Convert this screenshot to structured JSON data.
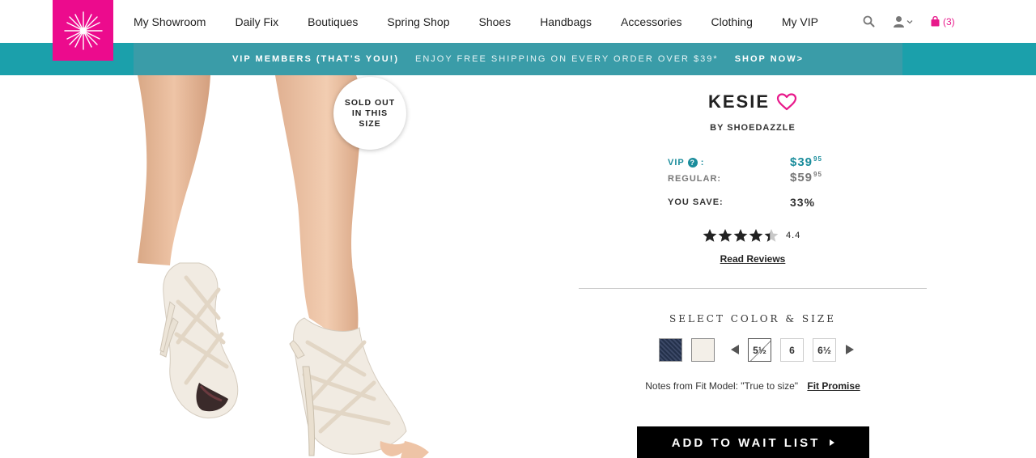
{
  "nav": {
    "items": [
      {
        "name": "nav-my-showroom",
        "label": "My Showroom"
      },
      {
        "name": "nav-daily-fix",
        "label": "Daily Fix"
      },
      {
        "name": "nav-boutiques",
        "label": "Boutiques"
      },
      {
        "name": "nav-spring-shop",
        "label": "Spring Shop"
      },
      {
        "name": "nav-shoes",
        "label": "Shoes"
      },
      {
        "name": "nav-handbags",
        "label": "Handbags"
      },
      {
        "name": "nav-accessories",
        "label": "Accessories"
      },
      {
        "name": "nav-clothing",
        "label": "Clothing"
      },
      {
        "name": "nav-my-vip",
        "label": "My VIP"
      }
    ],
    "bag_count": "(3)",
    "icons": [
      "search-icon",
      "user-icon",
      "chevron-down-icon",
      "shopping-bag-icon"
    ]
  },
  "promo": {
    "left": "VIP MEMBERS (THAT'S YOU!)",
    "middle": "ENJOY FREE SHIPPING ON EVERY ORDER OVER $39*",
    "cta": "SHOP NOW>"
  },
  "badge": {
    "line1": "SOLD OUT",
    "line2": "IN THIS",
    "line3": "SIZE"
  },
  "product": {
    "name": "KESIE",
    "brand": "BY SHOEDAZZLE",
    "vip_label": "VIP",
    "vip_colon": ":",
    "vip_price": "$39",
    "vip_cents": "95",
    "regular_label": "REGULAR:",
    "regular_price": "$59",
    "regular_cents": "95",
    "save_label": "YOU SAVE:",
    "save_value": "33%",
    "rating": 4.4,
    "rating_text": "4.4",
    "stars_max": 5,
    "read_reviews": "Read Reviews"
  },
  "selector": {
    "title": "SELECT COLOR & SIZE",
    "colors": [
      "denim",
      "cream"
    ],
    "sizes": [
      "5½",
      "6",
      "6½"
    ],
    "fit_notes": "Notes from Fit Model: \"True to size\"",
    "fit_promise": "Fit Promise"
  },
  "cta": {
    "label": "ADD TO WAIT LIST"
  },
  "colors": {
    "brand_pink": "#ec0b8d",
    "promo_teal": "#1ba0ab",
    "vip_teal": "#1b8d9c"
  }
}
